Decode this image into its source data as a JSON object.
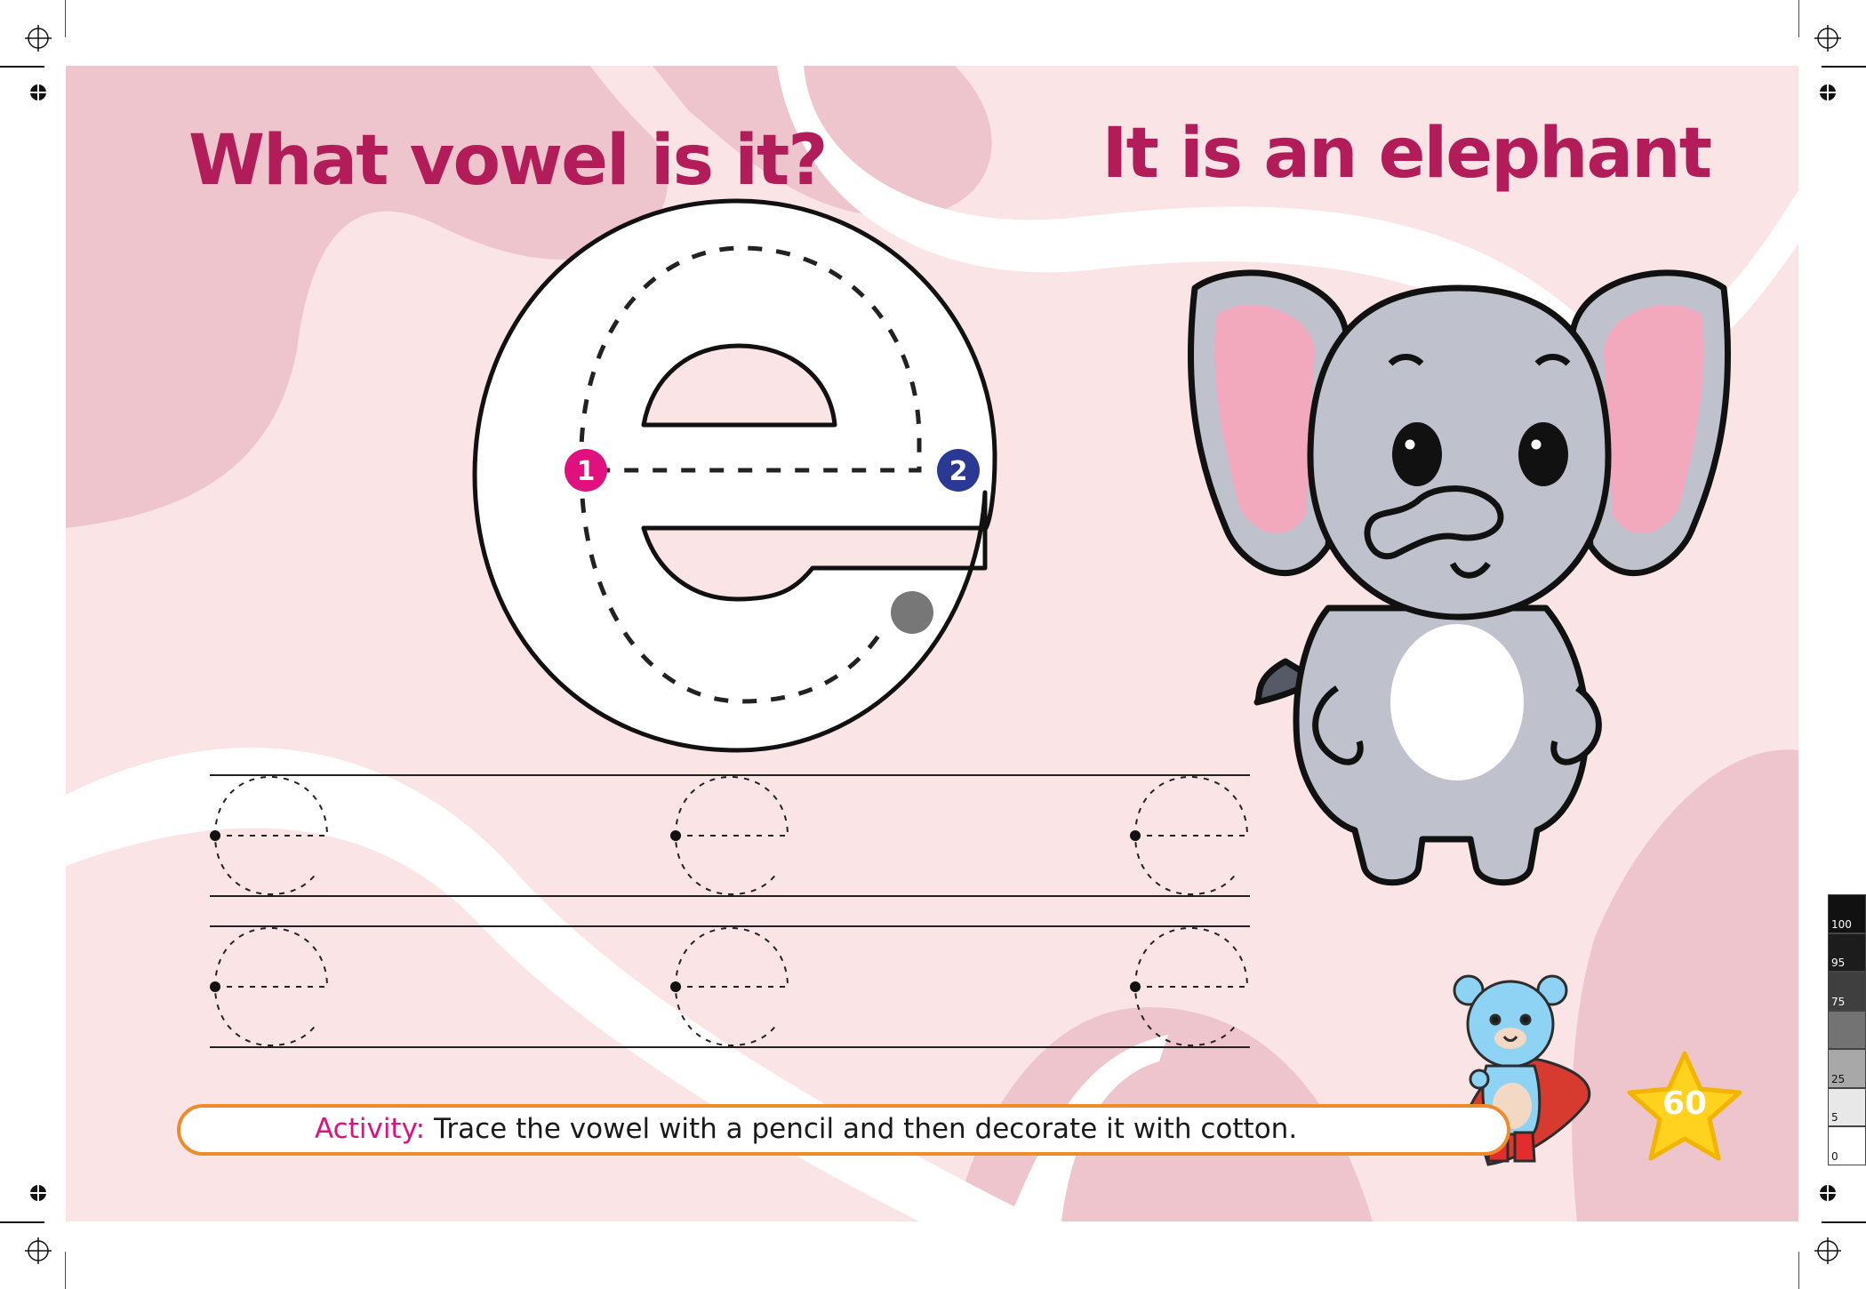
{
  "worksheet": {
    "title_question": "What vowel is it?",
    "title_answer": "It is an elephant",
    "letter": "e",
    "stroke_order": [
      "1",
      "2"
    ],
    "activity_label": "Activity:",
    "activity_text": "Trace the vowel with a pencil and then decorate it with cotton.",
    "page_number": "60"
  },
  "colors": {
    "title": "#b21d59",
    "page_background": "#fbe4e6",
    "blob": "#efc5cd",
    "stroke_1": "#e0117f",
    "stroke_2": "#2a3a94",
    "activity_border": "#ee8b2b",
    "star": "#ffd21f"
  },
  "icons": [
    "elephant-illustration",
    "bear-mascot-illustration",
    "star-badge",
    "registration-mark",
    "crop-mark"
  ],
  "print_color_bar": [
    "100",
    "95",
    "75",
    "25",
    "5",
    "0"
  ]
}
